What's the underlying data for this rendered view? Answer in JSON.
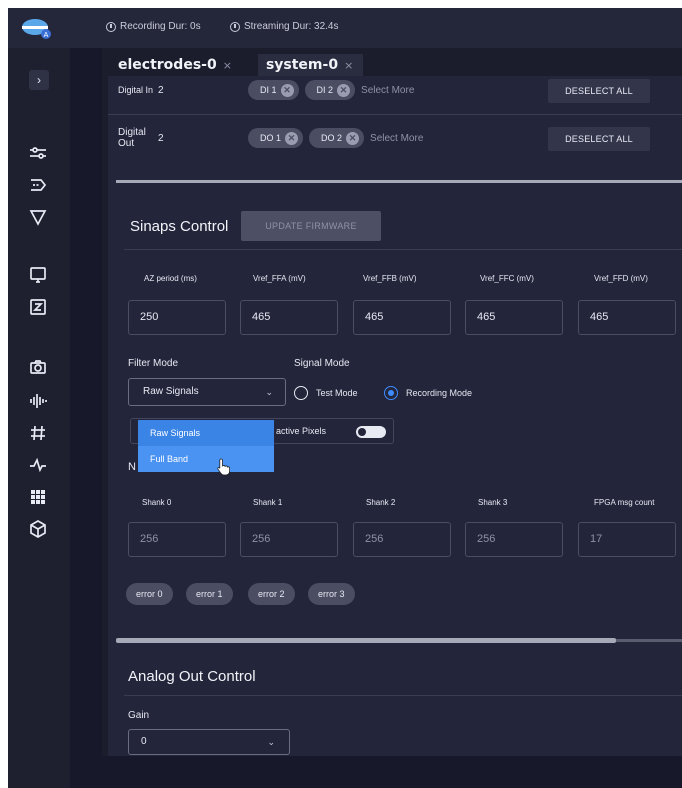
{
  "status_bar": {
    "recording": "Recording Dur: 0s",
    "streaming": "Streaming Dur: 32.4s"
  },
  "sidebar": {
    "expand_glyph": "›",
    "icons": [
      "sliders-icon",
      "stream-icon",
      "filter-icon",
      "monitor-icon",
      "z-box-icon",
      "camera-icon",
      "waveform-icon",
      "hash-icon",
      "pulse-icon",
      "grid-icon",
      "cube-icon"
    ]
  },
  "tabs": [
    {
      "label": "electrodes-0",
      "close": "×"
    },
    {
      "label": "system-0",
      "close": "×"
    }
  ],
  "digital_in": {
    "label": "Digital In",
    "count": "2",
    "chips": [
      "DI 1",
      "DI 2"
    ],
    "select_more": "Select More",
    "deselect": "DESELECT ALL"
  },
  "digital_out": {
    "label_line1": "Digital",
    "label_line2": "Out",
    "count": "2",
    "chips": [
      "DO 1",
      "DO 2"
    ],
    "select_more": "Select More",
    "deselect": "DESELECT ALL"
  },
  "sinaps": {
    "title": "Sinaps Control",
    "update_button": "UPDATE FIRMWARE",
    "fields": [
      {
        "label": "AZ period (ms)",
        "value": "250"
      },
      {
        "label": "Vref_FFA (mV)",
        "value": "465"
      },
      {
        "label": "Vref_FFB (mV)",
        "value": "465"
      },
      {
        "label": "Vref_FFC (mV)",
        "value": "465"
      },
      {
        "label": "Vref_FFD (mV)",
        "value": "465"
      }
    ],
    "filter_mode_label": "Filter Mode",
    "filter_mode_value": "Raw Signals",
    "signal_mode_label": "Signal Mode",
    "signal_modes": [
      {
        "label": "Test Mode",
        "selected": false
      },
      {
        "label": "Recording Mode",
        "selected": true
      }
    ],
    "inactive_pixels_label": "active Pixels",
    "n_label": "N",
    "dropdown_options": [
      "Raw Signals",
      "Full Band"
    ],
    "counters": [
      {
        "label": "Shank 0",
        "value": "256"
      },
      {
        "label": "Shank 1",
        "value": "256"
      },
      {
        "label": "Shank 2",
        "value": "256"
      },
      {
        "label": "Shank 3",
        "value": "256"
      },
      {
        "label": "FPGA msg count",
        "value": "17"
      }
    ],
    "errors": [
      "error 0",
      "error 1",
      "error 2",
      "error 3"
    ]
  },
  "analog": {
    "title": "Analog Out Control",
    "gain_label": "Gain",
    "gain_value": "0"
  },
  "colors": {
    "background": "#1b1d2c",
    "panel": "#23253a",
    "accent": "#3a84e6",
    "chip": "#4b4e63"
  }
}
